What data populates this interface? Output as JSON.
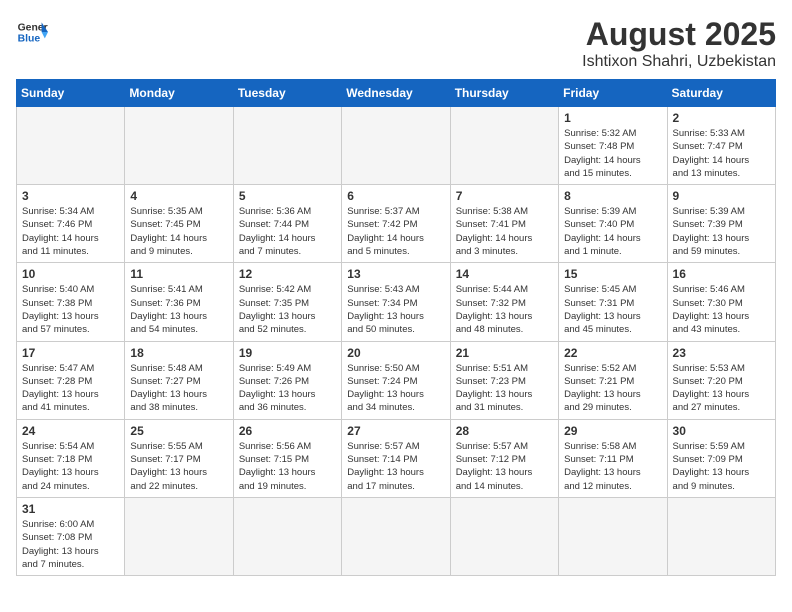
{
  "header": {
    "logo_general": "General",
    "logo_blue": "Blue",
    "month_year": "August 2025",
    "location": "Ishtixon Shahri, Uzbekistan"
  },
  "weekdays": [
    "Sunday",
    "Monday",
    "Tuesday",
    "Wednesday",
    "Thursday",
    "Friday",
    "Saturday"
  ],
  "weeks": [
    [
      {
        "day": "",
        "info": ""
      },
      {
        "day": "",
        "info": ""
      },
      {
        "day": "",
        "info": ""
      },
      {
        "day": "",
        "info": ""
      },
      {
        "day": "",
        "info": ""
      },
      {
        "day": "1",
        "info": "Sunrise: 5:32 AM\nSunset: 7:48 PM\nDaylight: 14 hours\nand 15 minutes."
      },
      {
        "day": "2",
        "info": "Sunrise: 5:33 AM\nSunset: 7:47 PM\nDaylight: 14 hours\nand 13 minutes."
      }
    ],
    [
      {
        "day": "3",
        "info": "Sunrise: 5:34 AM\nSunset: 7:46 PM\nDaylight: 14 hours\nand 11 minutes."
      },
      {
        "day": "4",
        "info": "Sunrise: 5:35 AM\nSunset: 7:45 PM\nDaylight: 14 hours\nand 9 minutes."
      },
      {
        "day": "5",
        "info": "Sunrise: 5:36 AM\nSunset: 7:44 PM\nDaylight: 14 hours\nand 7 minutes."
      },
      {
        "day": "6",
        "info": "Sunrise: 5:37 AM\nSunset: 7:42 PM\nDaylight: 14 hours\nand 5 minutes."
      },
      {
        "day": "7",
        "info": "Sunrise: 5:38 AM\nSunset: 7:41 PM\nDaylight: 14 hours\nand 3 minutes."
      },
      {
        "day": "8",
        "info": "Sunrise: 5:39 AM\nSunset: 7:40 PM\nDaylight: 14 hours\nand 1 minute."
      },
      {
        "day": "9",
        "info": "Sunrise: 5:39 AM\nSunset: 7:39 PM\nDaylight: 13 hours\nand 59 minutes."
      }
    ],
    [
      {
        "day": "10",
        "info": "Sunrise: 5:40 AM\nSunset: 7:38 PM\nDaylight: 13 hours\nand 57 minutes."
      },
      {
        "day": "11",
        "info": "Sunrise: 5:41 AM\nSunset: 7:36 PM\nDaylight: 13 hours\nand 54 minutes."
      },
      {
        "day": "12",
        "info": "Sunrise: 5:42 AM\nSunset: 7:35 PM\nDaylight: 13 hours\nand 52 minutes."
      },
      {
        "day": "13",
        "info": "Sunrise: 5:43 AM\nSunset: 7:34 PM\nDaylight: 13 hours\nand 50 minutes."
      },
      {
        "day": "14",
        "info": "Sunrise: 5:44 AM\nSunset: 7:32 PM\nDaylight: 13 hours\nand 48 minutes."
      },
      {
        "day": "15",
        "info": "Sunrise: 5:45 AM\nSunset: 7:31 PM\nDaylight: 13 hours\nand 45 minutes."
      },
      {
        "day": "16",
        "info": "Sunrise: 5:46 AM\nSunset: 7:30 PM\nDaylight: 13 hours\nand 43 minutes."
      }
    ],
    [
      {
        "day": "17",
        "info": "Sunrise: 5:47 AM\nSunset: 7:28 PM\nDaylight: 13 hours\nand 41 minutes."
      },
      {
        "day": "18",
        "info": "Sunrise: 5:48 AM\nSunset: 7:27 PM\nDaylight: 13 hours\nand 38 minutes."
      },
      {
        "day": "19",
        "info": "Sunrise: 5:49 AM\nSunset: 7:26 PM\nDaylight: 13 hours\nand 36 minutes."
      },
      {
        "day": "20",
        "info": "Sunrise: 5:50 AM\nSunset: 7:24 PM\nDaylight: 13 hours\nand 34 minutes."
      },
      {
        "day": "21",
        "info": "Sunrise: 5:51 AM\nSunset: 7:23 PM\nDaylight: 13 hours\nand 31 minutes."
      },
      {
        "day": "22",
        "info": "Sunrise: 5:52 AM\nSunset: 7:21 PM\nDaylight: 13 hours\nand 29 minutes."
      },
      {
        "day": "23",
        "info": "Sunrise: 5:53 AM\nSunset: 7:20 PM\nDaylight: 13 hours\nand 27 minutes."
      }
    ],
    [
      {
        "day": "24",
        "info": "Sunrise: 5:54 AM\nSunset: 7:18 PM\nDaylight: 13 hours\nand 24 minutes."
      },
      {
        "day": "25",
        "info": "Sunrise: 5:55 AM\nSunset: 7:17 PM\nDaylight: 13 hours\nand 22 minutes."
      },
      {
        "day": "26",
        "info": "Sunrise: 5:56 AM\nSunset: 7:15 PM\nDaylight: 13 hours\nand 19 minutes."
      },
      {
        "day": "27",
        "info": "Sunrise: 5:57 AM\nSunset: 7:14 PM\nDaylight: 13 hours\nand 17 minutes."
      },
      {
        "day": "28",
        "info": "Sunrise: 5:57 AM\nSunset: 7:12 PM\nDaylight: 13 hours\nand 14 minutes."
      },
      {
        "day": "29",
        "info": "Sunrise: 5:58 AM\nSunset: 7:11 PM\nDaylight: 13 hours\nand 12 minutes."
      },
      {
        "day": "30",
        "info": "Sunrise: 5:59 AM\nSunset: 7:09 PM\nDaylight: 13 hours\nand 9 minutes."
      }
    ],
    [
      {
        "day": "31",
        "info": "Sunrise: 6:00 AM\nSunset: 7:08 PM\nDaylight: 13 hours\nand 7 minutes."
      },
      {
        "day": "",
        "info": ""
      },
      {
        "day": "",
        "info": ""
      },
      {
        "day": "",
        "info": ""
      },
      {
        "day": "",
        "info": ""
      },
      {
        "day": "",
        "info": ""
      },
      {
        "day": "",
        "info": ""
      }
    ]
  ]
}
